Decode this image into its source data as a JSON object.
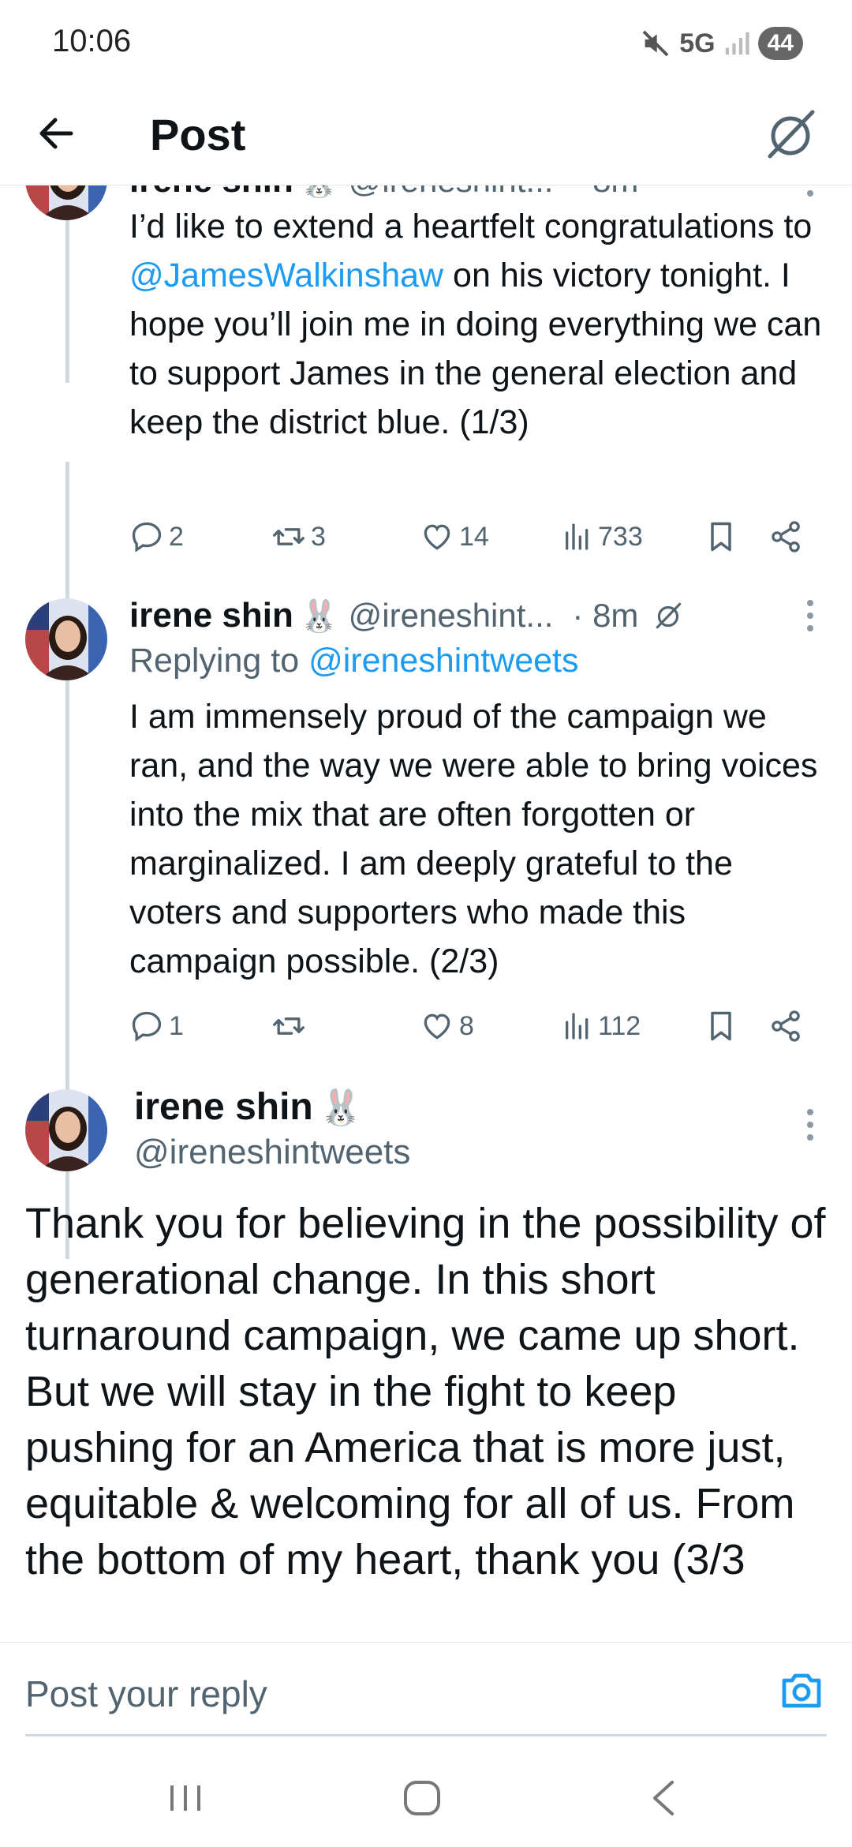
{
  "status_bar": {
    "time": "10:06",
    "network": "5G",
    "battery": "44"
  },
  "header": {
    "title": "Post"
  },
  "posts": [
    {
      "name_partial": "irene shin",
      "handle_partial": "@ireneshint...",
      "time_partial": "· 8m",
      "text_before": "I’d like to extend a heartfelt congratulations to ",
      "mention": "@JamesWalkinshaw",
      "text_after": " on his victory tonight. I hope you’ll join me in doing everything we can to support James in the general election and keep the district blue. (1/3)",
      "replies": "2",
      "reposts": "3",
      "likes": "14",
      "views": "733"
    },
    {
      "name": "irene shin",
      "handle": "@ireneshint...",
      "time": "· 8m",
      "replying_prefix": "Replying to ",
      "replying_to": "@ireneshintweets",
      "text": "I am immensely proud of the campaign we ran, and the way we were able to bring voices into the mix that are often forgotten or marginalized. I am deeply grateful to the voters and supporters who made this campaign possible. (2/3)",
      "replies": "1",
      "reposts": "",
      "likes": "8",
      "views": "112"
    }
  ],
  "main_post": {
    "name": "irene shin",
    "emoji": "🐰",
    "handle": "@ireneshintweets",
    "text": "Thank you for believing in the possibility of generational change. In this short turnaround campaign, we came up short. But we will stay in the fight to keep pushing for an America that is more just, equitable & welcoming for all of us. From the bottom of my heart, thank you (3/3"
  },
  "reply_bar": {
    "placeholder": "Post your reply"
  },
  "colors": {
    "link": "#1d9bf0",
    "secondary_text": "#536471",
    "thread_line": "#cfd9de"
  },
  "icons": [
    "back-arrow-icon",
    "grok-icon",
    "reply-icon",
    "repost-icon",
    "like-icon",
    "views-icon",
    "bookmark-icon",
    "share-icon",
    "more-icon",
    "camera-icon",
    "recents-icon",
    "home-icon",
    "nav-back-icon"
  ]
}
